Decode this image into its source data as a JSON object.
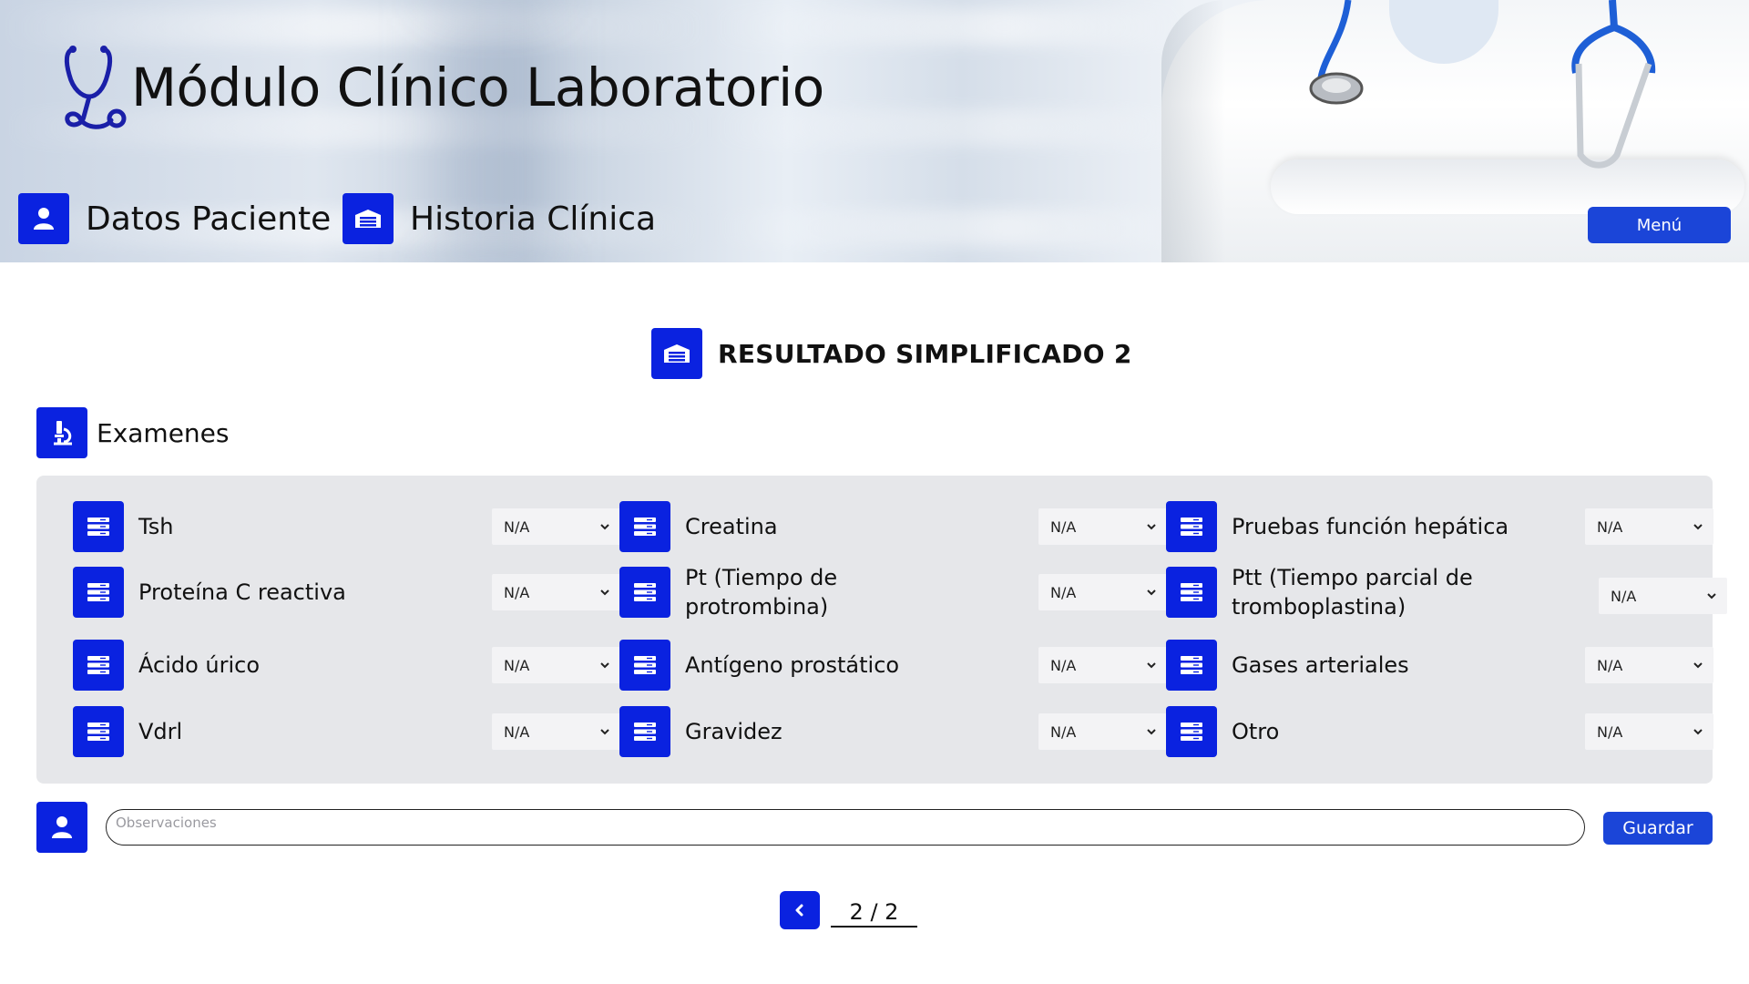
{
  "header": {
    "app_title": "Módulo Clínico Laboratorio",
    "nav": [
      {
        "label": "Datos Paciente",
        "icon": "user-icon"
      },
      {
        "label": "Historia Clínica",
        "icon": "archive-icon"
      }
    ],
    "menu_label": "Menú"
  },
  "section": {
    "title": "RESULTADO SIMPLIFICADO 2",
    "icon": "archive-icon"
  },
  "exams": {
    "heading": "Examenes",
    "heading_icon": "microscope-icon",
    "item_icon": "server-icon",
    "items": [
      {
        "label": "Tsh",
        "value": "N/A"
      },
      {
        "label": "Creatina",
        "value": "N/A"
      },
      {
        "label": "Pruebas función hepática",
        "value": "N/A"
      },
      {
        "label": "Proteína C reactiva",
        "value": "N/A"
      },
      {
        "label": "Pt (Tiempo de protrombina)",
        "value": "N/A"
      },
      {
        "label": "Ptt (Tiempo parcial de tromboplastina)",
        "value": "N/A"
      },
      {
        "label": "Ácido úrico",
        "value": "N/A"
      },
      {
        "label": "Antígeno prostático",
        "value": "N/A"
      },
      {
        "label": "Gases arteriales",
        "value": "N/A"
      },
      {
        "label": "Vdrl",
        "value": "N/A"
      },
      {
        "label": "Gravidez",
        "value": "N/A"
      },
      {
        "label": "Otro",
        "value": "N/A"
      }
    ]
  },
  "observations": {
    "placeholder": "Observaciones",
    "icon": "user-icon",
    "save_label": "Guardar"
  },
  "pagination": {
    "label": "2 / 2",
    "prev_icon": "chevron-left-icon"
  },
  "colors": {
    "accent": "#0a22e0",
    "button": "#1b45d8",
    "panel": "#e6e7ea"
  }
}
